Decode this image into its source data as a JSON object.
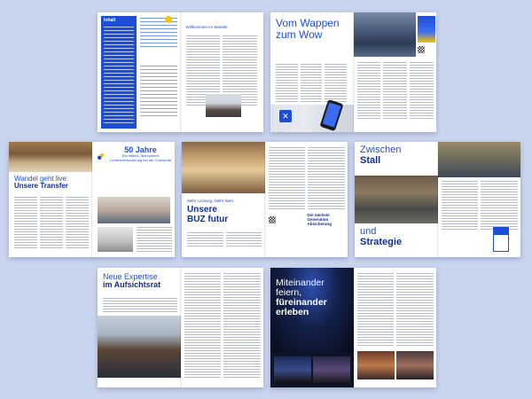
{
  "spreads": {
    "toc": {
      "label": "Inhalt",
      "welcome": "Willkommen im Wandel."
    },
    "wappen": {
      "line1": "Vom Wappen",
      "line2": "zum Wow"
    },
    "transfer": {
      "line1": "Wandel geht live:",
      "line2": "Unsere Transfer"
    },
    "jubilee": {
      "years": "50 Jahre",
      "subtitle": "Ein halbes Jahrhundert Lebensversicherung bei der Concordia"
    },
    "futur": {
      "kicker": "Mehr Leistung. Mehr Wert.",
      "line1": "Unsere",
      "line2": "BUZ futur",
      "side": "Die nächste Generation Absicherung"
    },
    "stall": {
      "line1": "Zwischen",
      "line2": "Stall",
      "line3": "und",
      "line4": "Strategie"
    },
    "expertise": {
      "line1": "Neue Expertise",
      "line2": "im Aufsichtsrat"
    },
    "feiern": {
      "line1": "Miteinander",
      "line2": "feiern,",
      "line3": "füreinander",
      "line4": "erleben"
    }
  },
  "colors": {
    "background": "#c9d4ee",
    "brand_blue": "#1d4fd6",
    "dark_blue": "#0f2f8e"
  }
}
